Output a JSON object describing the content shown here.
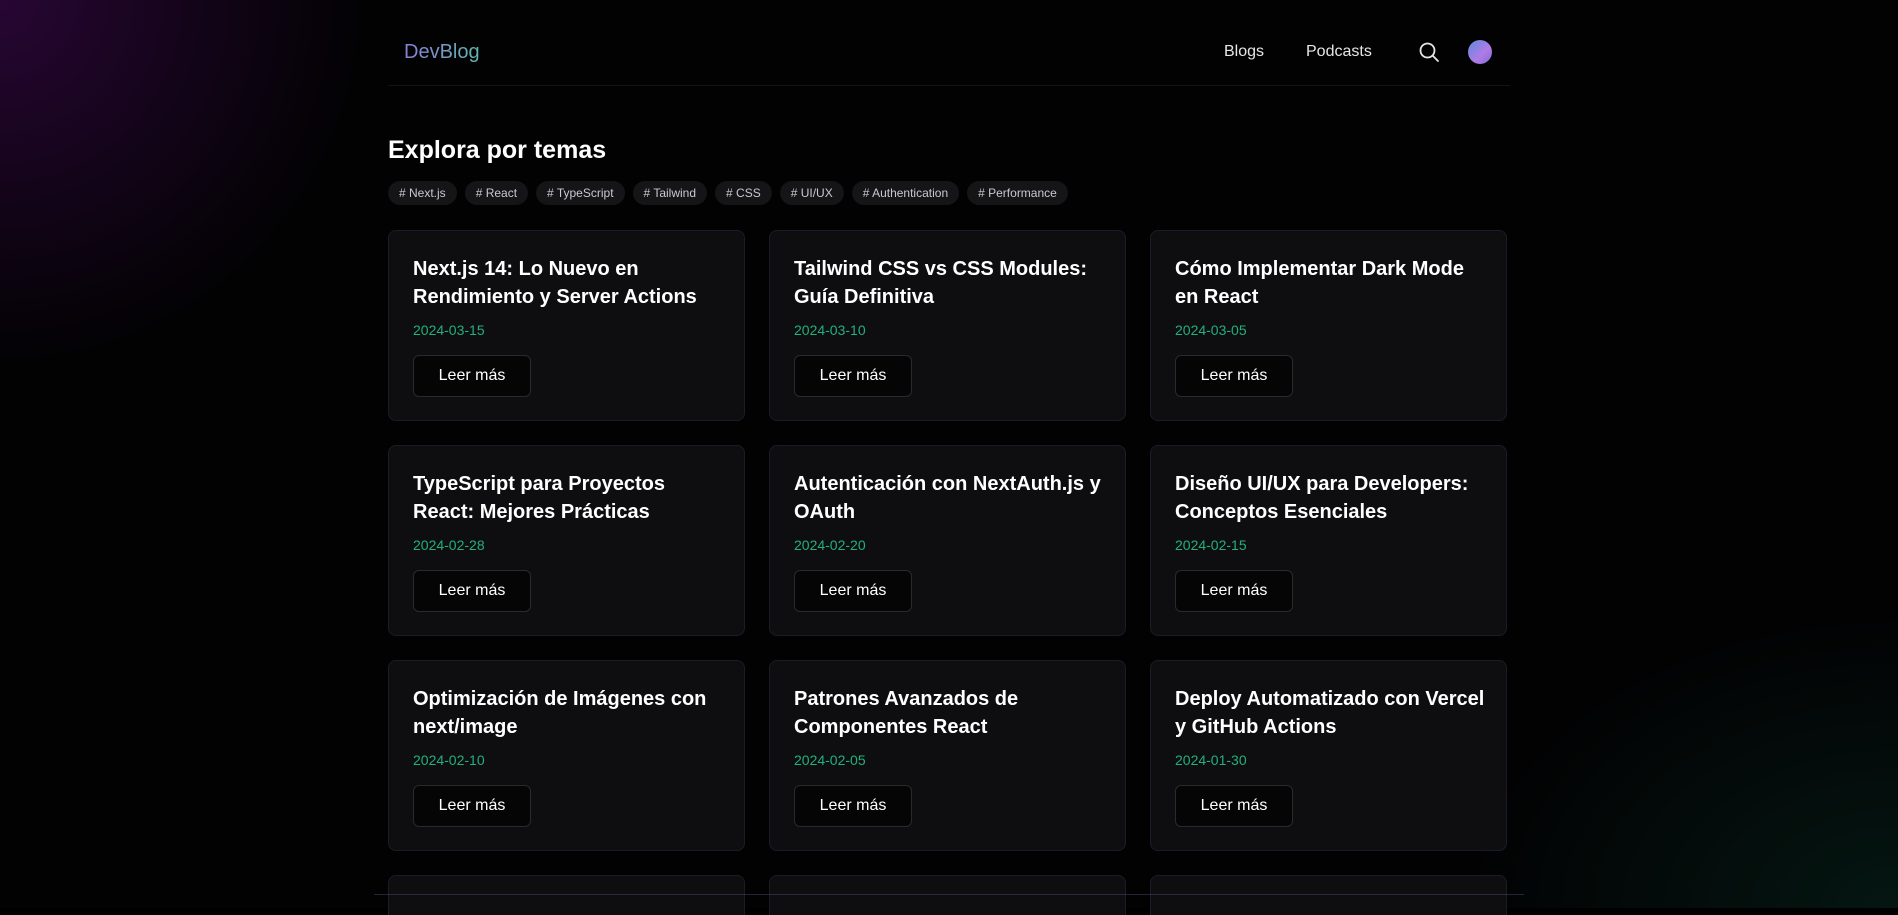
{
  "header": {
    "logo": "DevBlog",
    "nav": [
      {
        "label": "Blogs"
      },
      {
        "label": "Podcasts"
      }
    ]
  },
  "topics": {
    "title": "Explora por temas",
    "tags": [
      "# Next.js",
      "# React",
      "# TypeScript",
      "# Tailwind",
      "# CSS",
      "# UI/UX",
      "# Authentication",
      "# Performance"
    ]
  },
  "posts": [
    {
      "title": "Next.js 14: Lo Nuevo en Rendimiento y Server Actions",
      "date": "2024-03-15",
      "cta": "Leer más"
    },
    {
      "title": "Tailwind CSS vs CSS Modules: Guía Definitiva",
      "date": "2024-03-10",
      "cta": "Leer más"
    },
    {
      "title": "Cómo Implementar Dark Mode en React",
      "date": "2024-03-05",
      "cta": "Leer más"
    },
    {
      "title": "TypeScript para Proyectos React: Mejores Prácticas",
      "date": "2024-02-28",
      "cta": "Leer más"
    },
    {
      "title": "Autenticación con NextAuth.js y OAuth",
      "date": "2024-02-20",
      "cta": "Leer más"
    },
    {
      "title": "Diseño UI/UX para Developers: Conceptos Esenciales",
      "date": "2024-02-15",
      "cta": "Leer más"
    },
    {
      "title": "Optimización de Imágenes con next/image",
      "date": "2024-02-10",
      "cta": "Leer más"
    },
    {
      "title": "Patrones Avanzados de Componentes React",
      "date": "2024-02-05",
      "cta": "Leer más"
    },
    {
      "title": "Deploy Automatizado con Vercel y GitHub Actions",
      "date": "2024-01-30",
      "cta": "Leer más"
    }
  ],
  "icons": {
    "search": "search-icon",
    "avatar": "avatar"
  },
  "colors": {
    "accent_date": "#22b07b",
    "logo_gradient_start": "#8b7ed8",
    "logo_gradient_end": "#5fb7b0",
    "card_bg": "#0e0e10",
    "card_border": "#1e1a28"
  }
}
